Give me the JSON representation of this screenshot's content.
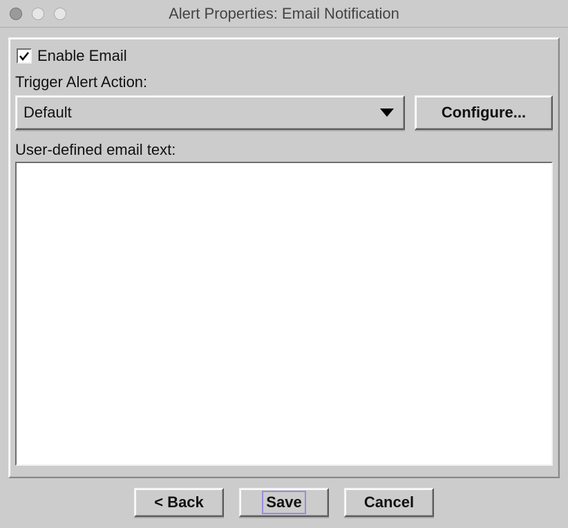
{
  "window": {
    "title": "Alert Properties: Email Notification"
  },
  "panel": {
    "enable_email_label": "Enable Email",
    "enable_email_checked": true,
    "trigger_label": "Trigger Alert Action:",
    "trigger_value": "Default",
    "configure_label": "Configure...",
    "user_text_label": "User-defined email text:",
    "user_text_value": ""
  },
  "footer": {
    "back_label": "< Back",
    "save_label": "Save",
    "cancel_label": "Cancel"
  }
}
